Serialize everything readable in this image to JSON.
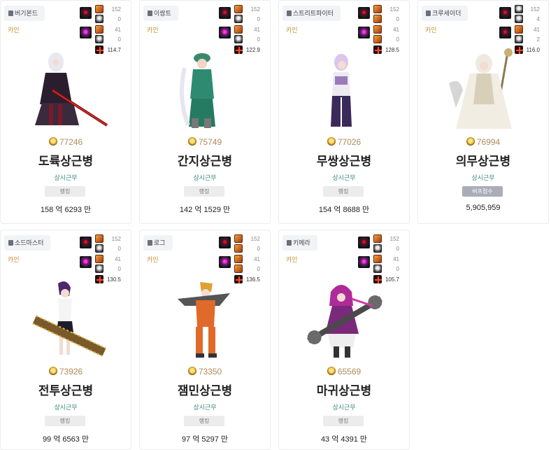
{
  "colors": {
    "server": "#c98a2e",
    "guild": "#3a8a7a",
    "fame": "#b08a5a"
  },
  "cards": [
    {
      "job": "버기본드",
      "server": "카인",
      "stats": [
        "152",
        "0",
        "41",
        "0",
        "114.7"
      ],
      "fame": "77246",
      "name": "도륙상근병",
      "guild": "상시근무",
      "badge": "랭킹",
      "gold": "158 억 6293 만"
    },
    {
      "job": "이쌈트",
      "server": "카인",
      "stats": [
        "152",
        "0",
        "41",
        "0",
        "122.9"
      ],
      "fame": "75749",
      "name": "간지상근병",
      "guild": "상시근무",
      "badge": "랭킹",
      "gold": "142 억 1529 만"
    },
    {
      "job": "스트리트파이터",
      "server": "카인",
      "stats": [
        "152",
        "0",
        "41",
        "0",
        "128.5"
      ],
      "fame": "77026",
      "name": "무쌍상근병",
      "guild": "상시근무",
      "badge": "랭킹",
      "gold": "154 억 8688 만"
    },
    {
      "job": "크루세이더",
      "server": "카인",
      "stats": [
        "152",
        "4",
        "41",
        "2",
        "116.0"
      ],
      "fame": "76994",
      "name": "의무상근병",
      "guild": "상시근무",
      "badge": "버프점수",
      "gold": "5,905,959"
    },
    {
      "job": "소드마스터",
      "server": "카인",
      "stats": [
        "152",
        "0",
        "41",
        "0",
        "130.5"
      ],
      "fame": "73926",
      "name": "전투상근병",
      "guild": "상시근무",
      "badge": "랭킹",
      "gold": "99 억 6563 만"
    },
    {
      "job": "로그",
      "server": "카인",
      "stats": [
        "152",
        "0",
        "41",
        "0",
        "136.5"
      ],
      "fame": "73350",
      "name": "잼민상근병",
      "guild": "상시근무",
      "badge": "랭킹",
      "gold": "97 억 5297 만"
    },
    {
      "job": "키메라",
      "server": "카인",
      "stats": [
        "152",
        "0",
        "41",
        "0",
        "105.7"
      ],
      "fame": "65569",
      "name": "마귀상근병",
      "guild": "상시근무",
      "badge": "랭킹",
      "gold": "43 억 4391 만"
    }
  ]
}
